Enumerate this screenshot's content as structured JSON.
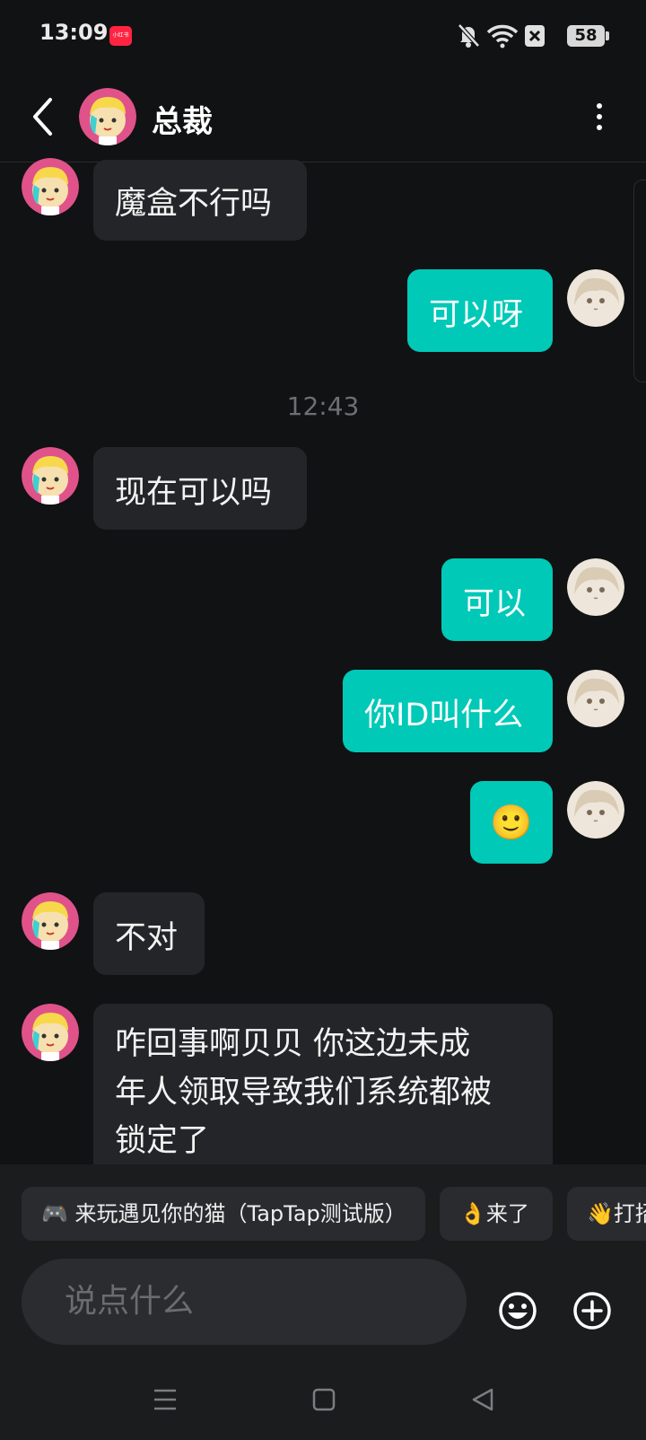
{
  "status_bar": {
    "time": "13:09",
    "app_badge": "小红书",
    "battery": "58",
    "icons": [
      "mute-bell-icon",
      "wifi-icon",
      "close-box-icon",
      "battery-icon"
    ]
  },
  "header": {
    "back_icon": "chevron-left-icon",
    "contact_name": "总裁",
    "menu_icon": "more-vertical-icon"
  },
  "messages": [
    {
      "side": "in",
      "text": "魔盒不行吗"
    },
    {
      "side": "out",
      "text": "可以呀"
    },
    {
      "side": "time",
      "text": "12:43"
    },
    {
      "side": "in",
      "text": "现在可以吗"
    },
    {
      "side": "out",
      "text": "可以"
    },
    {
      "side": "out",
      "text": "你ID叫什么"
    },
    {
      "side": "out",
      "text": "🙂",
      "emoji": true
    },
    {
      "side": "in",
      "text": "不对"
    },
    {
      "side": "in",
      "lines": [
        "咋回事啊贝贝 你这边未成",
        "年人领取导致我们系统都被",
        "锁定了"
      ]
    }
  ],
  "quick_replies": [
    {
      "label": "🎮 来玩遇见你的猫（TapTap测试版）"
    },
    {
      "label": "👌来了"
    },
    {
      "label": "👋打招"
    }
  ],
  "composer": {
    "placeholder": "说点什么",
    "emoji_icon": "smiley-icon",
    "add_icon": "plus-circle-icon"
  },
  "nav_bar": {
    "icons": [
      "menu-icon",
      "home-square-icon",
      "back-triangle-icon"
    ]
  },
  "colors": {
    "background": "#111213",
    "outgoing_bubble": "#00c9b7",
    "incoming_bubble": "#242528",
    "panel": "#1b1c1e"
  }
}
